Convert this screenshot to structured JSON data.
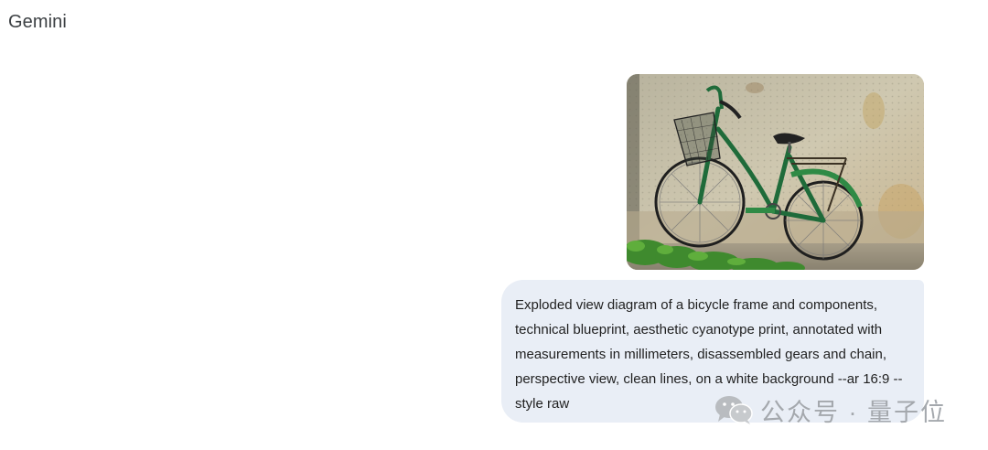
{
  "header": {
    "app_title": "Gemini"
  },
  "conversation": {
    "user_message": {
      "image_description_icon": "bicycle-photo",
      "prompt_text": "Exploded view diagram of a bicycle frame and components, technical blueprint, aesthetic cyanotype print, annotated with measurements in millimeters, disassembled gears and chain, perspective view, clean lines, on a white background --ar 16:9 --style raw"
    }
  },
  "watermark": {
    "text": "公众号 · 量子位",
    "icon": "wechat-logo-icon"
  },
  "colors": {
    "bubble_background": "#e9eef6",
    "title_text": "#3c4043",
    "bike_frame": "#1f6b3a"
  }
}
